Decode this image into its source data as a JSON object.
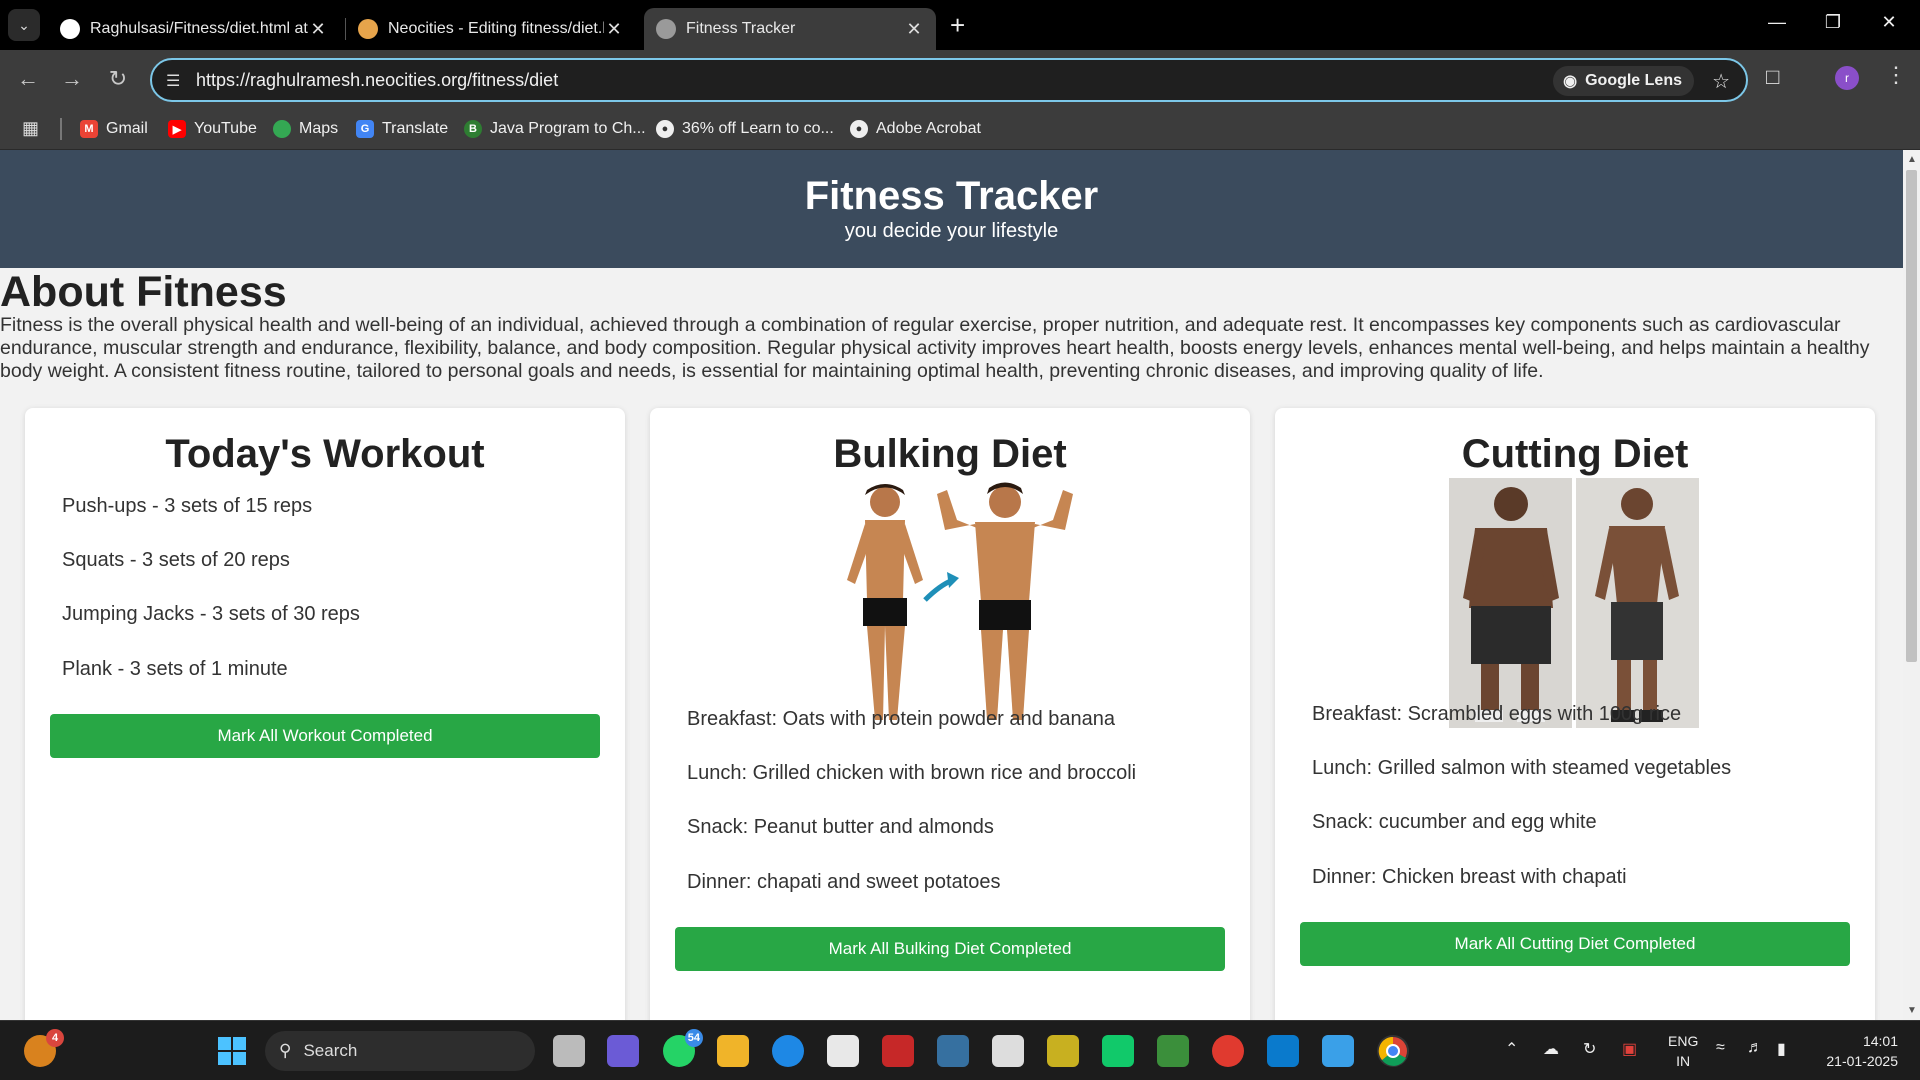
{
  "browser": {
    "tabs": [
      {
        "title": "Raghulsasi/Fitness/diet.html at",
        "favicon": "github-icon"
      },
      {
        "title": "Neocities - Editing fitness/diet.h",
        "favicon": "neocities-icon"
      },
      {
        "title": "Fitness Tracker",
        "favicon": "globe-icon"
      }
    ],
    "new_tab": "+",
    "url": "https://raghulramesh.neocities.org/fitness/diet",
    "lens_label": "Google Lens",
    "profile_initial": "r",
    "bookmarks": [
      {
        "label": "Gmail",
        "icon": "gmail-icon",
        "color": "#ea4335"
      },
      {
        "label": "YouTube",
        "icon": "youtube-icon",
        "color": "#ff0000"
      },
      {
        "label": "Maps",
        "icon": "maps-icon",
        "color": "#34a853"
      },
      {
        "label": "Translate",
        "icon": "translate-icon",
        "color": "#4285f4"
      },
      {
        "label": "Java Program to Ch...",
        "icon": "java-icon",
        "color": "#2e7d32"
      },
      {
        "label": "36% off Learn to co...",
        "icon": "globe-icon",
        "color": "#555555"
      },
      {
        "label": "Adobe Acrobat",
        "icon": "globe-icon",
        "color": "#555555"
      }
    ]
  },
  "page": {
    "header": {
      "title": "Fitness Tracker",
      "tagline": "you decide your lifestyle"
    },
    "about": {
      "heading": "About Fitness",
      "text": "Fitness is the overall physical health and well-being of an individual, achieved through a combination of regular exercise, proper nutrition, and adequate rest. It encompasses key components such as cardiovascular endurance, muscular strength and endurance, flexibility, balance, and body composition. Regular physical activity improves heart health, boosts energy levels, enhances mental well-being, and helps maintain a healthy body weight. A consistent fitness routine, tailored to personal goals and needs, is essential for maintaining optimal health, preventing chronic diseases, and improving quality of life."
    },
    "workout": {
      "title": "Today's Workout",
      "items": [
        "Push-ups - 3 sets of 15 reps",
        "Squats - 3 sets of 20 reps",
        "Jumping Jacks - 3 sets of 30 reps",
        "Plank - 3 sets of 1 minute"
      ],
      "button": "Mark All Workout Completed"
    },
    "bulking": {
      "title": "Bulking Diet",
      "items": [
        "Breakfast: Oats with protein powder and banana",
        "Lunch: Grilled chicken with brown rice and broccoli",
        "Snack: Peanut butter and almonds",
        "Dinner: chapati and sweet potatoes"
      ],
      "button": "Mark All Bulking Diet Completed"
    },
    "cutting": {
      "title": "Cutting Diet",
      "items": [
        "Breakfast: Scrambled eggs with 100g rice",
        "Lunch: Grilled salmon with steamed vegetables",
        "Snack: cucumber and egg white",
        "Dinner: Chicken breast with chapati"
      ],
      "button": "Mark All Cutting Diet Completed"
    },
    "accent_color": "#28a745",
    "header_color": "#3b4b5d"
  },
  "taskbar": {
    "search_label": "Search",
    "widget_badge": "4",
    "whatsapp_badge": "54",
    "language": "ENG",
    "region": "IN",
    "time": "14:01",
    "date": "21-01-2025"
  }
}
